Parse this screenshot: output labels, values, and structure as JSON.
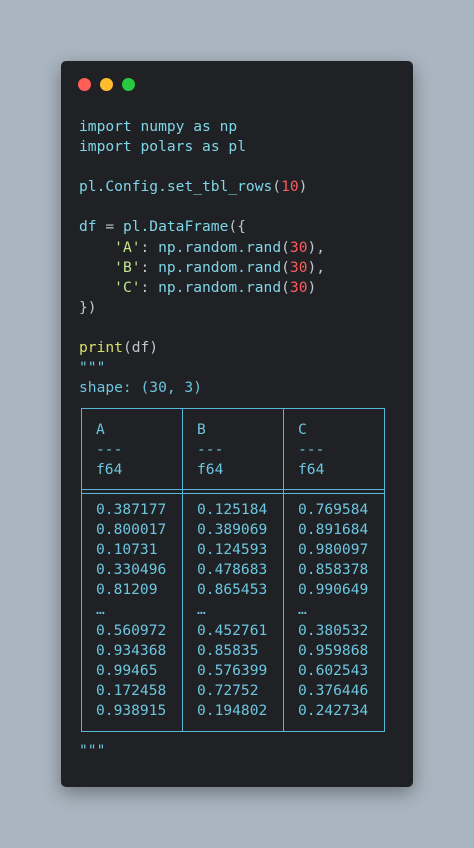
{
  "window": {
    "controls": [
      {
        "name": "close",
        "color": "#ff5f56"
      },
      {
        "name": "minimize",
        "color": "#ffbd2e"
      },
      {
        "name": "maximize",
        "color": "#27c93f"
      }
    ]
  },
  "code": {
    "line1": {
      "kw": "import",
      "mod": "numpy",
      "as": "as",
      "alias": "np"
    },
    "line2": {
      "kw": "import",
      "mod": "polars",
      "as": "as",
      "alias": "pl"
    },
    "line3": {
      "obj": "pl.Config.set_tbl_rows",
      "open": "(",
      "arg": "10",
      "close": ")"
    },
    "line4": {
      "lhs": "df",
      "eq": " = ",
      "call": "pl.DataFrame",
      "open": "({"
    },
    "entries": [
      {
        "key": "'A'",
        "call": "np.random.rand",
        "arg": "30",
        "trail": "),"
      },
      {
        "key": "'B'",
        "call": "np.random.rand",
        "arg": "30",
        "trail": "),"
      },
      {
        "key": "'C'",
        "call": "np.random.rand",
        "arg": "30",
        "trail": ")"
      }
    ],
    "close_line": "})",
    "print_fn": "print",
    "print_arg": "(df)",
    "quotes_open": "\"\"\"",
    "shape_line": "shape: (30, 3)",
    "quotes_close": "\"\"\""
  },
  "table": {
    "columns": [
      {
        "name": "A",
        "sep": "---",
        "dtype": "f64"
      },
      {
        "name": "B",
        "sep": "---",
        "dtype": "f64"
      },
      {
        "name": "C",
        "sep": "---",
        "dtype": "f64"
      }
    ],
    "rows": [
      [
        "0.387177",
        "0.125184",
        "0.769584"
      ],
      [
        "0.800017",
        "0.389069",
        "0.891684"
      ],
      [
        "0.10731",
        "0.124593",
        "0.980097"
      ],
      [
        "0.330496",
        "0.478683",
        "0.858378"
      ],
      [
        "0.81209",
        "0.865453",
        "0.990649"
      ],
      [
        "…",
        "…",
        "…"
      ],
      [
        "0.560972",
        "0.452761",
        "0.380532"
      ],
      [
        "0.934368",
        "0.85835",
        "0.959868"
      ],
      [
        "0.99465",
        "0.576399",
        "0.602543"
      ],
      [
        "0.172458",
        "0.72752",
        "0.376446"
      ],
      [
        "0.938915",
        "0.194802",
        "0.242734"
      ]
    ]
  }
}
